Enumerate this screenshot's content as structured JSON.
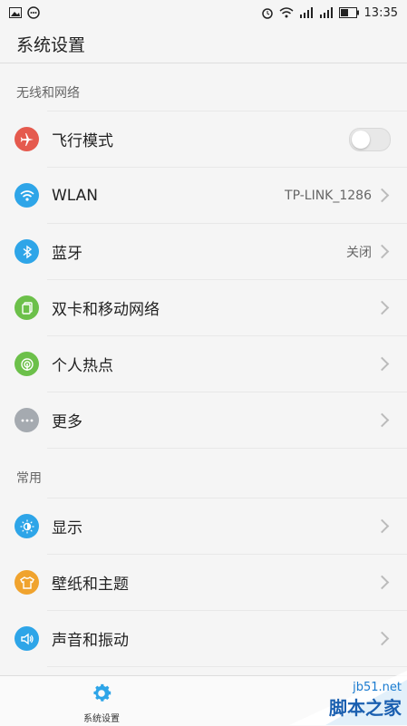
{
  "status_bar": {
    "time": "13:35",
    "icons": [
      "image-icon",
      "message-icon",
      "alarm-icon",
      "wifi-icon",
      "signal-icon",
      "signal-icon",
      "battery-icon"
    ]
  },
  "header": {
    "title": "系统设置"
  },
  "sections": [
    {
      "title": "无线和网络",
      "items": [
        {
          "label": "飞行模式",
          "icon": "airplane-icon",
          "color": "#e55a4e",
          "control": "toggle",
          "toggle_on": false
        },
        {
          "label": "WLAN",
          "icon": "wifi-icon",
          "color": "#2ea5e8",
          "value": "TP-LINK_1286"
        },
        {
          "label": "蓝牙",
          "icon": "bluetooth-icon",
          "color": "#2ea5e8",
          "value": "关闭"
        },
        {
          "label": "双卡和移动网络",
          "icon": "sim-card-icon",
          "color": "#6cc04a"
        },
        {
          "label": "个人热点",
          "icon": "hotspot-icon",
          "color": "#6cc04a"
        },
        {
          "label": "更多",
          "icon": "more-icon",
          "color": "#a5aab0"
        }
      ]
    },
    {
      "title": "常用",
      "items": [
        {
          "label": "显示",
          "icon": "brightness-icon",
          "color": "#2ea5e8"
        },
        {
          "label": "壁纸和主题",
          "icon": "tshirt-icon",
          "color": "#f0a32e"
        },
        {
          "label": "声音和振动",
          "icon": "speaker-icon",
          "color": "#2ea5e8"
        }
      ]
    }
  ],
  "bottom_nav": {
    "label": "系统设置",
    "icon": "gear-icon",
    "color": "#2ea5e8"
  },
  "watermark": {
    "url": "jb51.net",
    "text": "脚本之家"
  }
}
